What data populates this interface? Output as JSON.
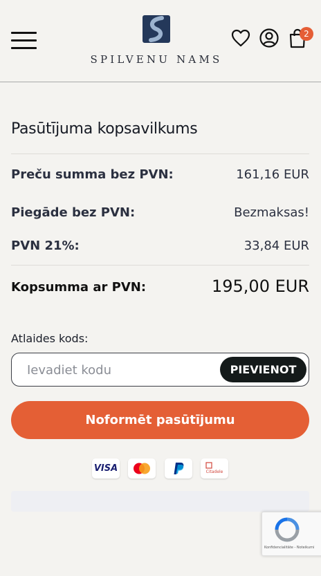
{
  "header": {
    "logo_text": "SPILVENU NAMS",
    "cart_count": "2",
    "badge_color": "#e55e36",
    "icons": [
      "hamburger-menu-icon",
      "heart-icon",
      "user-icon",
      "cart-icon"
    ]
  },
  "summary": {
    "title": "Pasūtījuma kopsavilkums",
    "rows": [
      {
        "label": "Preču summa bez PVN:",
        "value": "161,16 EUR"
      },
      {
        "label": "Piegāde bez PVN:",
        "value": "Bezmaksas!"
      },
      {
        "label": "PVN 21%:",
        "value": "33,84 EUR"
      }
    ],
    "total_label": "Kopsumma ar PVN:",
    "total_value": "195,00 EUR"
  },
  "coupon": {
    "label": "Atlaides kods:",
    "placeholder": "Ievadiet kodu",
    "value": "",
    "button": "PIEVIENOT"
  },
  "checkout": {
    "button": "Noformēt pasūtījumu",
    "color": "#e45f35"
  },
  "payment_methods": [
    {
      "name": "visa",
      "text": "VISA"
    },
    {
      "name": "mastercard",
      "text": ""
    },
    {
      "name": "paypal",
      "text": ""
    },
    {
      "name": "citadele",
      "text": "Citadele"
    }
  ],
  "recaptcha": {
    "text": "Konfidencialitāte - Noteikumi"
  }
}
